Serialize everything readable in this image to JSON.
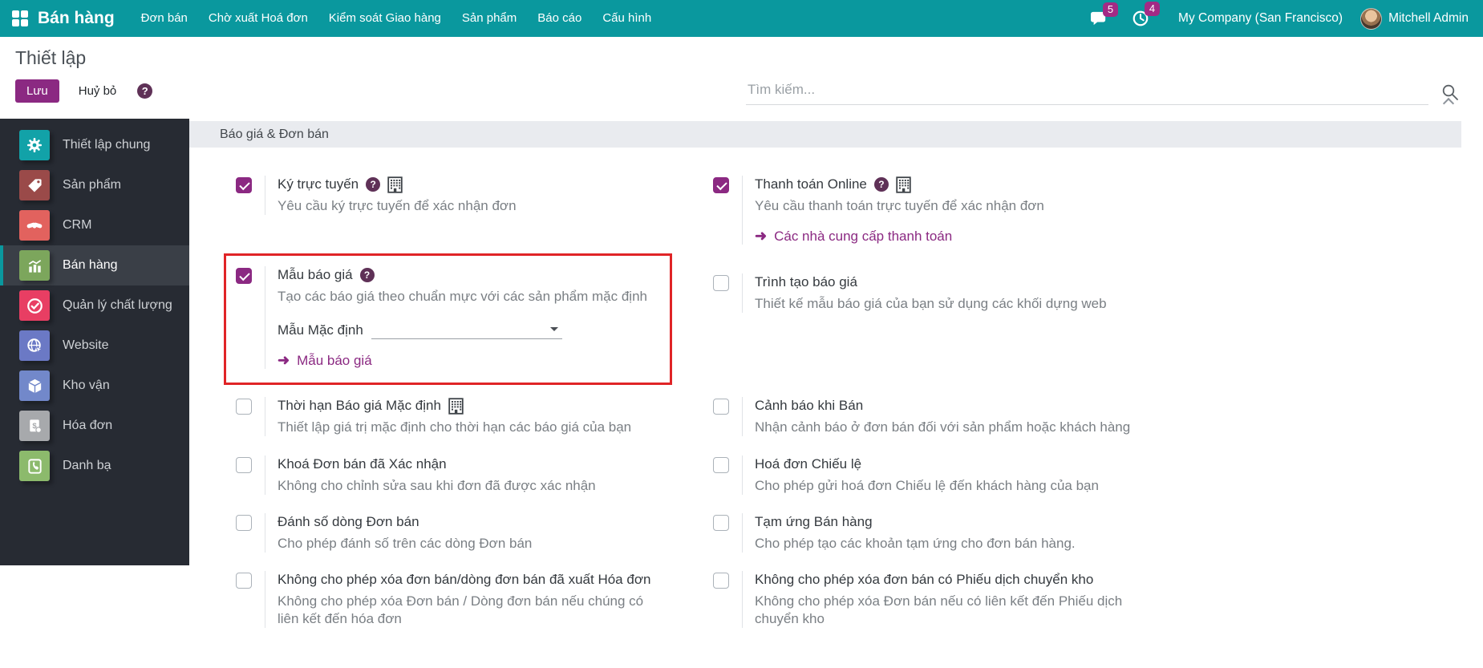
{
  "colors": {
    "navbar": "#0a989e",
    "accent": "#8b2982",
    "badge": "#a22a85",
    "highlight": "#e02427",
    "help": "#5f3157",
    "sidebarbg": "#272b33",
    "sidebaractive": "#3a3f47",
    "tile0": "#12a2a8",
    "tile1": "#9a4a49",
    "tile2": "#e2625e",
    "tile3": "#7ca65c",
    "tile4": "#e83e63",
    "tile5": "#6b79c5",
    "tile6": "#7288ca",
    "tile7": "#a7a9ac",
    "tile8": "#8cba6c"
  },
  "icons": {
    "help_glyph": "?",
    "link_arrow": "➜"
  },
  "navbar": {
    "app_name": "Bán hàng",
    "items": [
      "Đơn bán",
      "Chờ xuất Hoá đơn",
      "Kiểm soát Giao hàng",
      "Sản phẩm",
      "Báo cáo",
      "Cấu hình"
    ],
    "messages_badge": "5",
    "activities_badge": "4",
    "company": "My Company (San Francisco)",
    "user": "Mitchell Admin"
  },
  "control_panel": {
    "title": "Thiết lập",
    "save_label": "Lưu",
    "discard_label": "Huỷ bỏ",
    "search_placeholder": "Tìm kiếm..."
  },
  "sidebar": {
    "items": [
      {
        "label": "Thiết lập chung",
        "icon": "gear-icon"
      },
      {
        "label": "Sản phẩm",
        "icon": "tag-icon"
      },
      {
        "label": "CRM",
        "icon": "handshake-icon"
      },
      {
        "label": "Bán hàng",
        "icon": "bar-chart-icon",
        "active": true
      },
      {
        "label": "Quản lý chất lượng",
        "icon": "check-badge-icon"
      },
      {
        "label": "Website",
        "icon": "globe-icon"
      },
      {
        "label": "Kho vận",
        "icon": "box-icon"
      },
      {
        "label": "Hóa đơn",
        "icon": "invoice-icon"
      },
      {
        "label": "Danh bạ",
        "icon": "contact-icon"
      }
    ]
  },
  "section": {
    "title": "Báo giá & Đơn bán"
  },
  "settings": [
    {
      "checked": true,
      "label": "Ký trực tuyến",
      "desc": "Yêu cầu ký trực tuyến để xác nhận đơn"
    },
    {
      "checked": true,
      "label": "Thanh toán Online",
      "desc": "Yêu cầu thanh toán trực tuyến để xác nhận đơn",
      "link_label": "Các nhà cung cấp thanh toán"
    },
    {
      "checked": true,
      "label": "Mẫu báo giá",
      "desc": "Tạo các báo giá theo chuẩn mực với các sản phẩm mặc định",
      "field_label": "Mẫu Mặc định",
      "field_value": "",
      "link_label": "Mẫu báo giá",
      "highlighted": true
    },
    {
      "checked": false,
      "label": "Trình tạo báo giá",
      "desc": "Thiết kế mẫu báo giá của bạn sử dụng các khối dựng web"
    },
    {
      "checked": false,
      "label": "Thời hạn Báo giá Mặc định",
      "desc": "Thiết lập giá trị mặc định cho thời hạn các báo giá của bạn"
    },
    {
      "checked": false,
      "label": "Cảnh báo khi Bán",
      "desc": "Nhận cảnh báo ở đơn bán đối với sản phẩm hoặc khách hàng"
    },
    {
      "checked": false,
      "label": "Khoá Đơn bán đã Xác nhận",
      "desc": "Không cho chỉnh sửa sau khi đơn đã được xác nhận"
    },
    {
      "checked": false,
      "label": "Hoá đơn Chiếu lệ",
      "desc": "Cho phép gửi hoá đơn Chiếu lệ đến khách hàng của bạn"
    },
    {
      "checked": false,
      "label": "Đánh số dòng Đơn bán",
      "desc": "Cho phép đánh số trên các dòng Đơn bán"
    },
    {
      "checked": false,
      "label": "Tạm ứng Bán hàng",
      "desc": "Cho phép tạo các khoản tạm ứng cho đơn bán hàng."
    },
    {
      "checked": false,
      "label": "Không cho phép xóa đơn bán/dòng đơn bán đã xuất Hóa đơn",
      "desc": "Không cho phép xóa Đơn bán / Dòng đơn bán nếu chúng có liên kết đến hóa đơn"
    },
    {
      "checked": false,
      "label": "Không cho phép xóa đơn bán có Phiếu dịch chuyển kho",
      "desc": "Không cho phép xóa Đơn bán nếu có liên kết đến Phiếu dịch chuyển kho"
    }
  ]
}
